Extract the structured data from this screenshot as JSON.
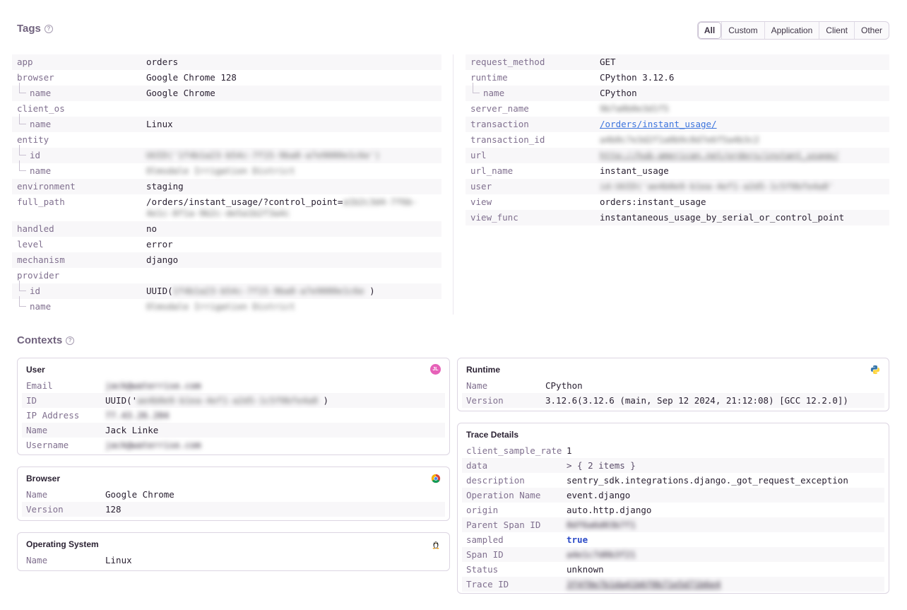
{
  "tags": {
    "title": "Tags",
    "help_glyph": "?",
    "filters": [
      "All",
      "Custom",
      "Application",
      "Client",
      "Other"
    ],
    "active_filter": "All",
    "left": [
      {
        "key": "app",
        "value": "orders",
        "child": false
      },
      {
        "key": "browser",
        "value": "Google Chrome 128",
        "child": false
      },
      {
        "key": "name",
        "value": "Google Chrome",
        "child": true
      },
      {
        "key": "client_os",
        "value": "",
        "child": false
      },
      {
        "key": "name",
        "value": "Linux",
        "child": true
      },
      {
        "key": "entity",
        "value": "",
        "child": false
      },
      {
        "key": "id",
        "value": "UUID('1f4b1a23-b54c-7f15-9ba8-a7e9080e1c6e')",
        "child": true,
        "blurred": true
      },
      {
        "key": "name",
        "value": "Olmsdale Irrigation District",
        "child": true,
        "blurred": true
      },
      {
        "key": "environment",
        "value": "staging",
        "child": false
      },
      {
        "key": "full_path",
        "value": "/orders/instant_usage/?control_point=",
        "value_blurred": "a1b2c3d4-7f6b-4e1c-8f1a-9b2c-de5a1b2f3a4c",
        "child": false,
        "multiline": true
      },
      {
        "key": "handled",
        "value": "no",
        "child": false
      },
      {
        "key": "level",
        "value": "error",
        "child": false
      },
      {
        "key": "mechanism",
        "value": "django",
        "child": false
      },
      {
        "key": "provider",
        "value": "",
        "child": false
      },
      {
        "key": "id",
        "value": "UUID(",
        "value_blurred": "1f4b1a23-b54c-7f15-9ba8-a7e9080e1c6e",
        "value_suffix": " )",
        "child": true
      },
      {
        "key": "name",
        "value": "Olmsdale Irrigation District",
        "child": true,
        "blurred": true
      }
    ],
    "right": [
      {
        "key": "request_method",
        "value": "GET",
        "child": false
      },
      {
        "key": "runtime",
        "value": "CPython 3.12.6",
        "child": false
      },
      {
        "key": "name",
        "value": "CPython",
        "child": true
      },
      {
        "key": "server_name",
        "value": "9b7a0b0e3d1f5",
        "child": false,
        "blurred": true
      },
      {
        "key": "transaction",
        "value": "/orders/instant_usage/",
        "child": false,
        "link": true
      },
      {
        "key": "transaction_id",
        "value": "a4b8c7e3d2f1a0b9c8d7e6f5a4b3c2",
        "child": false,
        "blurred": true
      },
      {
        "key": "url",
        "value": "http://hub-american.net/orders/instant_usage/",
        "child": false,
        "link": true,
        "blurred": true
      },
      {
        "key": "url_name",
        "value": "instant_usage",
        "child": false
      },
      {
        "key": "user",
        "value": "id:UUID('ae4b0e9-b1ea-4ef1-a2d5-1c5f0bfe4a8'",
        "child": false,
        "blurred": true
      },
      {
        "key": "view",
        "value": "orders:instant_usage",
        "child": false
      },
      {
        "key": "view_func",
        "value": "instantaneous_usage_by_serial_or_control_point",
        "child": false
      }
    ]
  },
  "contexts": {
    "title": "Contexts",
    "help_glyph": "?",
    "user": {
      "title": "User",
      "avatar_initials": "JL",
      "rows": [
        {
          "key": "Email",
          "value": "jack@waterrise.com",
          "blurred": true
        },
        {
          "key": "ID",
          "value": "UUID('",
          "value_blurred": "ae4b0e9-b1ea-4ef1-a2d5-1c5f0bfe4a8",
          "value_suffix": " )"
        },
        {
          "key": "IP Address",
          "value": "77.43.26.204",
          "blurred": true
        },
        {
          "key": "Name",
          "value": "Jack Linke"
        },
        {
          "key": "Username",
          "value": "jack@waterrise.com",
          "blurred": true
        }
      ]
    },
    "browser": {
      "title": "Browser",
      "rows": [
        {
          "key": "Name",
          "value": "Google Chrome"
        },
        {
          "key": "Version",
          "value": "128"
        }
      ]
    },
    "os": {
      "title": "Operating System",
      "rows": [
        {
          "key": "Name",
          "value": "Linux"
        }
      ]
    },
    "runtime": {
      "title": "Runtime",
      "rows": [
        {
          "key": "Name",
          "value": "CPython"
        },
        {
          "key": "Version",
          "value": "3.12.6(3.12.6 (main, Sep 12 2024, 21:12:08) [GCC 12.2.0])"
        }
      ]
    },
    "trace": {
      "title": "Trace Details",
      "rows": [
        {
          "key": "client_sample_rate",
          "value": "1"
        },
        {
          "key": "data",
          "value": "> { 2 items }",
          "expander": true
        },
        {
          "key": "description",
          "value": "sentry_sdk.integrations.django._got_request_exception"
        },
        {
          "key": "Operation Name",
          "value": "event.django"
        },
        {
          "key": "origin",
          "value": "auto.http.django"
        },
        {
          "key": "Parent Span ID",
          "value": "8df6a6d03b7f1",
          "blurred": true
        },
        {
          "key": "sampled",
          "value": "true",
          "bool": true
        },
        {
          "key": "Span ID",
          "value": "a4e1c7d0b3f21",
          "blurred": true
        },
        {
          "key": "Status",
          "value": "unknown"
        },
        {
          "key": "Trace ID",
          "value": "3f4f0e7b1da41b6f0b71e5d71b6e4",
          "blurred": true,
          "link": true
        }
      ]
    }
  },
  "colors": {
    "accent": "#3c74dd",
    "key_text": "#80708f",
    "row_alt": "#f8f7f9",
    "border": "#dcd5e2"
  }
}
